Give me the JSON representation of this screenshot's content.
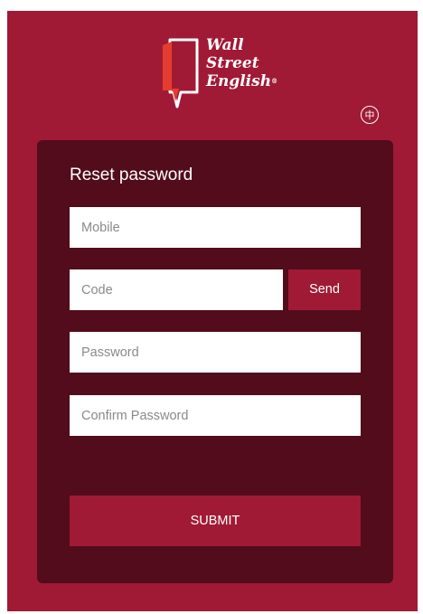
{
  "brand": {
    "logo_lines": [
      "Wall",
      "Street",
      "English"
    ],
    "registered_mark": "®"
  },
  "language_toggle": {
    "label": "中"
  },
  "form": {
    "title": "Reset password",
    "mobile": {
      "placeholder": "Mobile",
      "value": ""
    },
    "code": {
      "placeholder": "Code",
      "value": ""
    },
    "send_label": "Send",
    "password": {
      "placeholder": "Password",
      "value": ""
    },
    "confirm_password": {
      "placeholder": "Confirm Password",
      "value": ""
    },
    "submit_label": "SUBMIT"
  },
  "colors": {
    "background": "#a01a35",
    "panel": "#520c1c",
    "button": "#a01a35",
    "logo_accent": "#e63c2f"
  }
}
